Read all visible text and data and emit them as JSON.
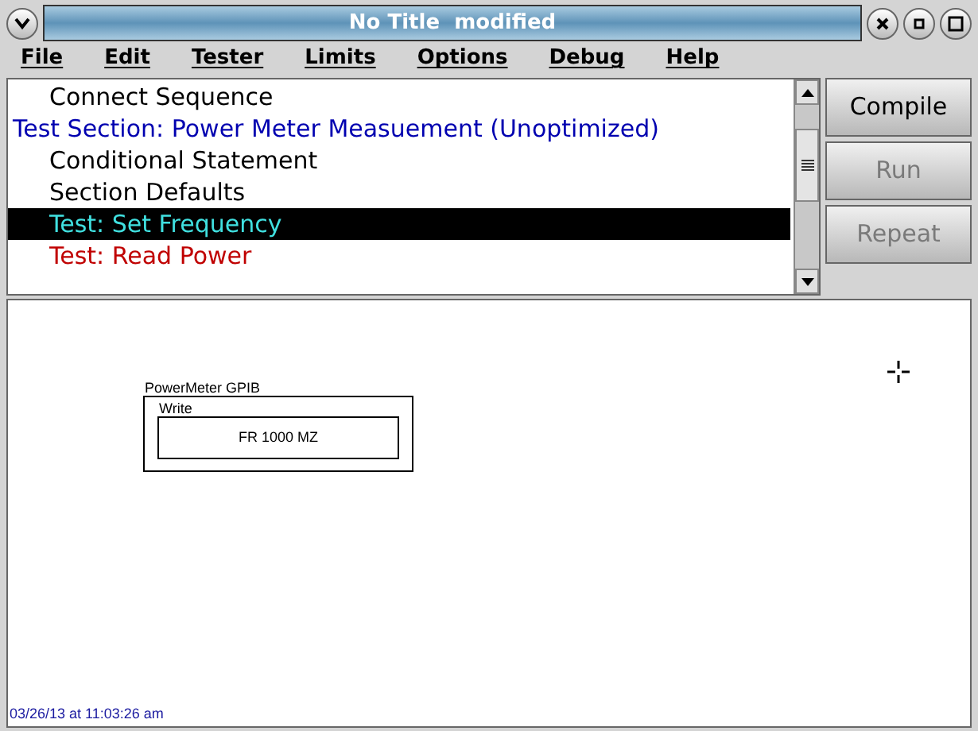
{
  "window": {
    "title": "No Title  modified"
  },
  "menu": [
    "File",
    "Edit",
    "Tester",
    "Limits",
    "Options",
    "Debug",
    "Help"
  ],
  "sequence": [
    {
      "kind": "entry",
      "label": "Connect Sequence",
      "color": "#000000",
      "selected": false
    },
    {
      "kind": "section",
      "label": "Test Section: Power Meter Measuement (Unoptimized)",
      "color": "#0000b0",
      "selected": false,
      "children": [
        {
          "kind": "entry",
          "label": "Conditional Statement",
          "color": "#000000",
          "selected": false
        },
        {
          "kind": "entry",
          "label": "Section Defaults",
          "color": "#000000",
          "selected": false
        },
        {
          "kind": "entry",
          "label": "Test: Set Frequency",
          "color": "#40e0e0",
          "selected": true
        },
        {
          "kind": "entry",
          "label": "Test: Read Power",
          "color": "#c00000",
          "selected": false
        }
      ]
    }
  ],
  "buttons": [
    {
      "label": "Compile",
      "disabled": false
    },
    {
      "label": "Run",
      "disabled": true
    },
    {
      "label": "Repeat",
      "disabled": true
    }
  ],
  "block": {
    "title": "PowerMeter GPIB",
    "operation": "Write",
    "command": "FR 1000 MZ"
  },
  "timestamp": "03/26/13 at 11:03:26 am"
}
